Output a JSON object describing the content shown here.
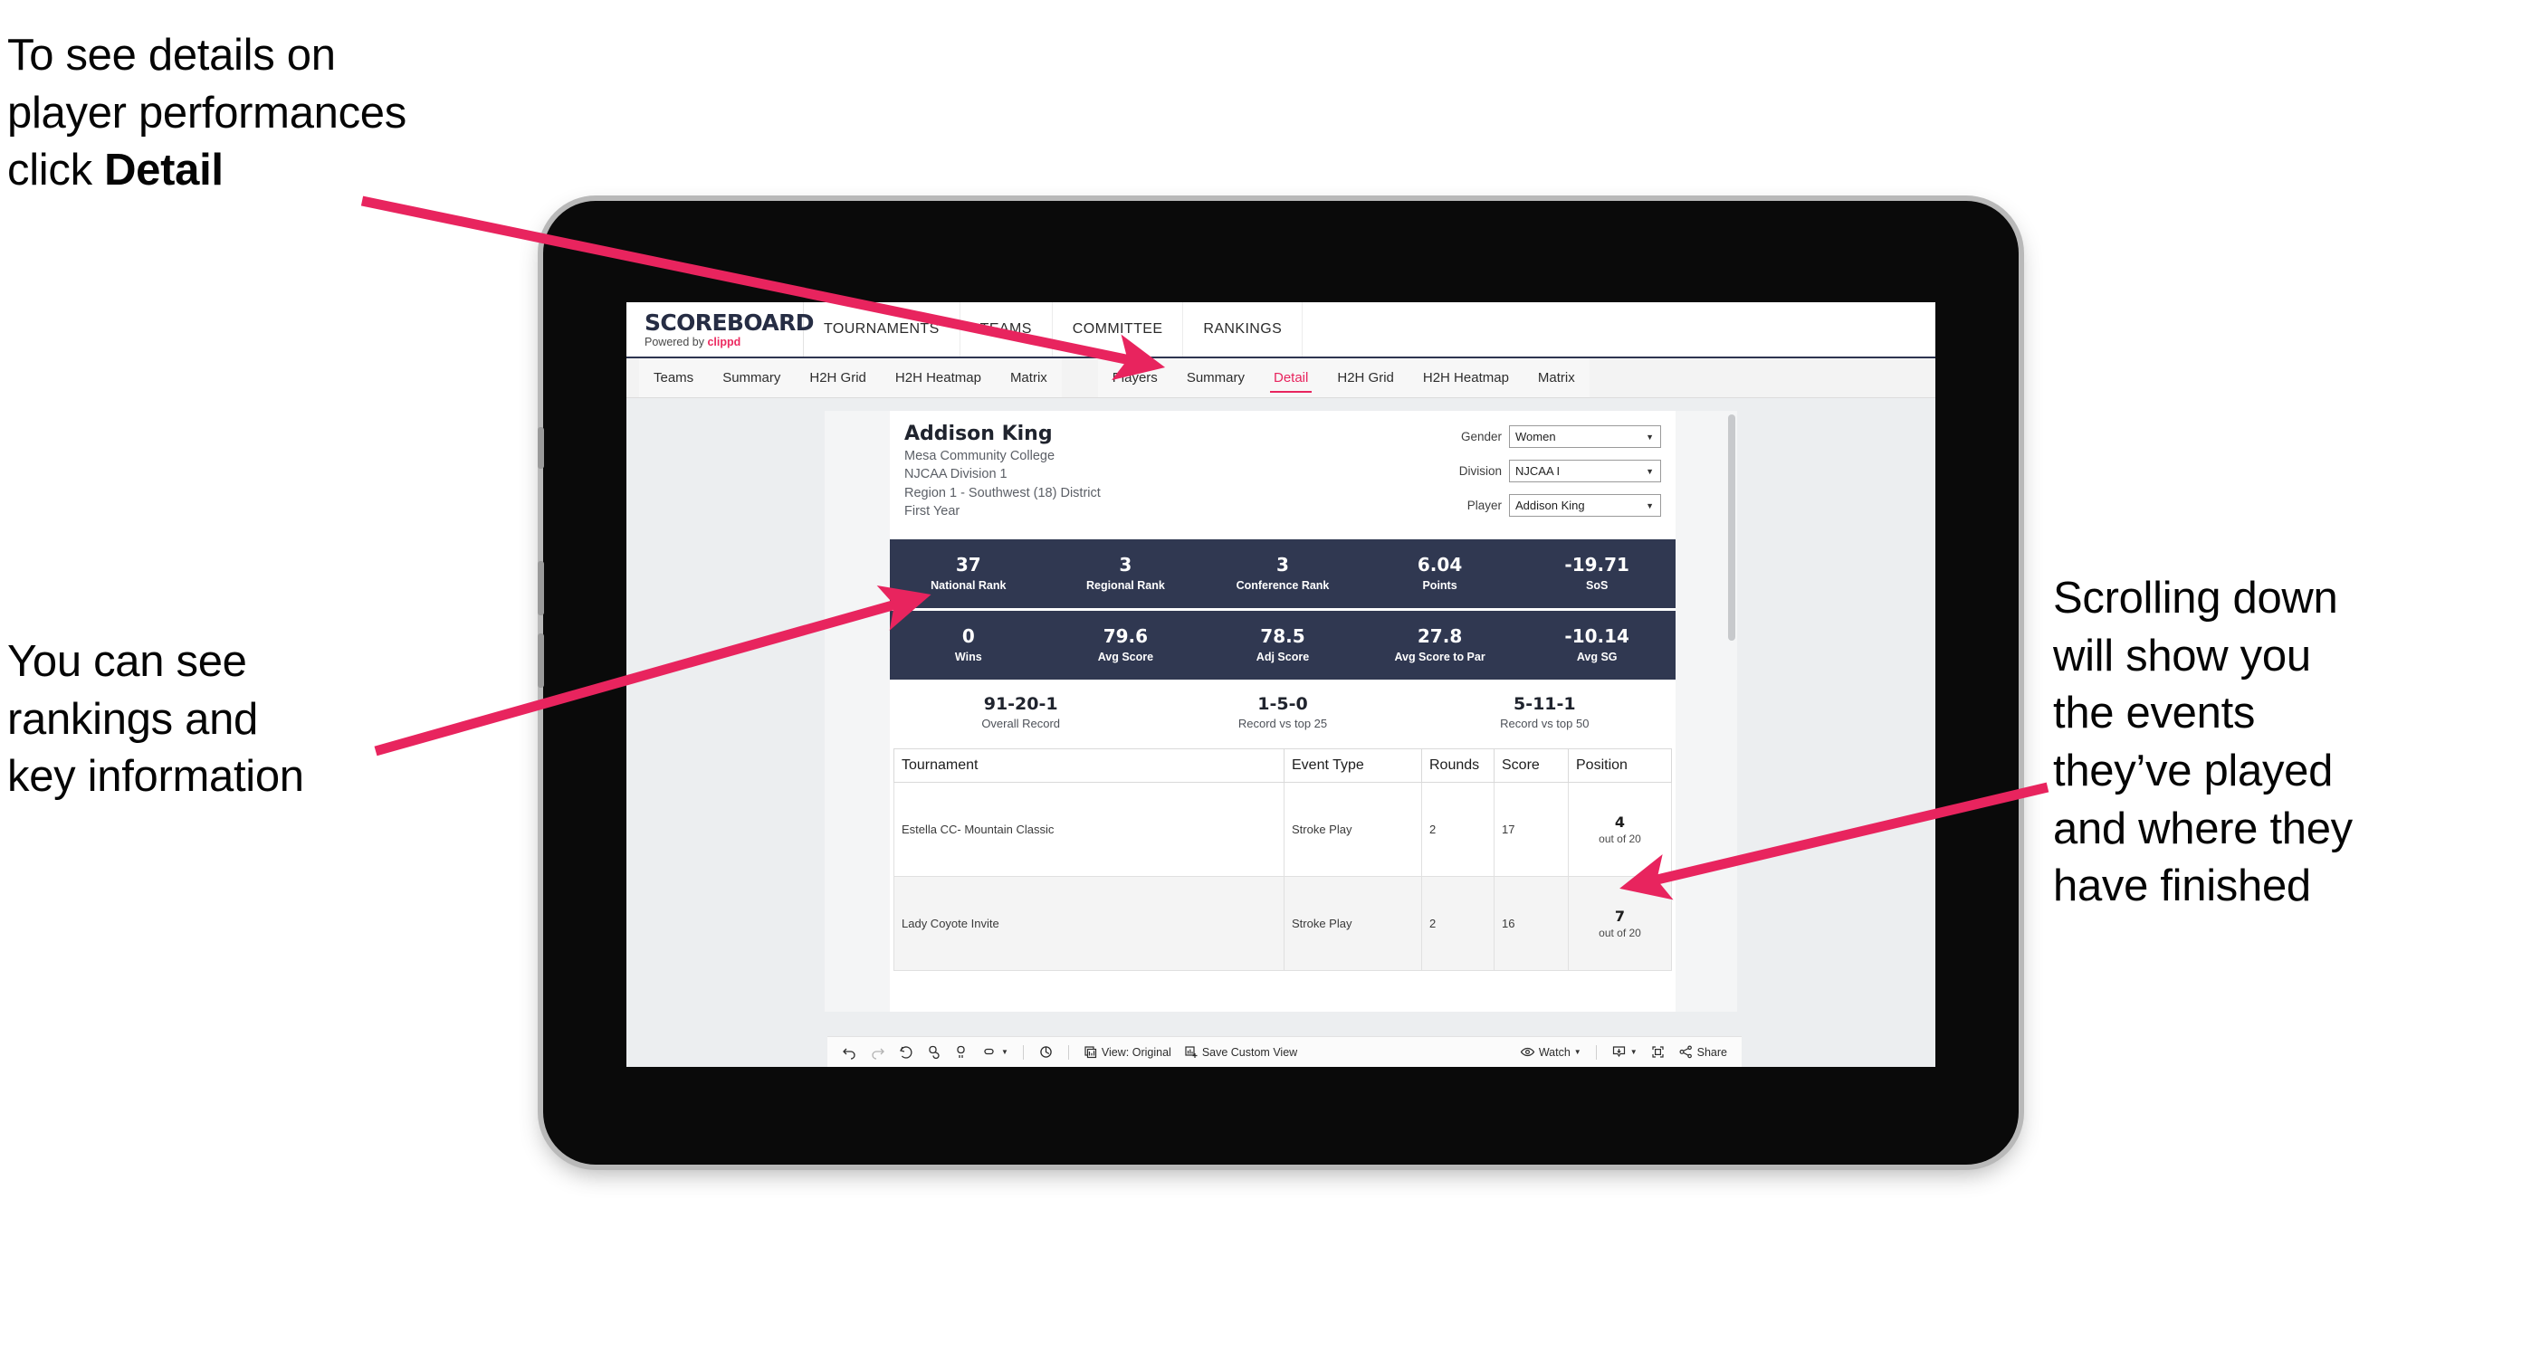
{
  "annotations": {
    "top_left_pre": "To see details on\nplayer performances\nclick ",
    "top_left_bold": "Detail",
    "mid_left": "You can see\nrankings and\nkey information",
    "right": "Scrolling down\nwill show you\nthe events\nthey’ve played\nand where they\nhave finished"
  },
  "colors": {
    "accent_pink": "#e8245e",
    "band_navy": "#303851",
    "brand_navy": "#262d44"
  },
  "app": {
    "brand": {
      "name": "SCOREBOARD",
      "powered_prefix": "Powered by ",
      "powered_brand": "clippd"
    },
    "top_nav": [
      {
        "label": "TOURNAMENTS"
      },
      {
        "label": "TEAMS"
      },
      {
        "label": "COMMITTEE"
      },
      {
        "label": "RANKINGS"
      }
    ],
    "tabs_left": [
      {
        "label": "Teams",
        "active": false
      },
      {
        "label": "Summary",
        "active": false
      },
      {
        "label": "H2H Grid",
        "active": false
      },
      {
        "label": "H2H Heatmap",
        "active": false
      },
      {
        "label": "Matrix",
        "active": false
      }
    ],
    "tabs_right": [
      {
        "label": "Players",
        "active": false
      },
      {
        "label": "Summary",
        "active": false
      },
      {
        "label": "Detail",
        "active": true
      },
      {
        "label": "H2H Grid",
        "active": false
      },
      {
        "label": "H2H Heatmap",
        "active": false
      },
      {
        "label": "Matrix",
        "active": false
      }
    ],
    "player": {
      "name": "Addison King",
      "school": "Mesa Community College",
      "division": "NJCAA Division 1",
      "region": "Region 1 - Southwest (18) District",
      "class_year": "First Year"
    },
    "filters": [
      {
        "label": "Gender",
        "value": "Women"
      },
      {
        "label": "Division",
        "value": "NJCAA I"
      },
      {
        "label": "Player",
        "value": "Addison King"
      }
    ],
    "stat_bands": [
      [
        {
          "value": "37",
          "label": "National Rank"
        },
        {
          "value": "3",
          "label": "Regional Rank"
        },
        {
          "value": "3",
          "label": "Conference Rank"
        },
        {
          "value": "6.04",
          "label": "Points"
        },
        {
          "value": "-19.71",
          "label": "SoS"
        }
      ],
      [
        {
          "value": "0",
          "label": "Wins"
        },
        {
          "value": "79.6",
          "label": "Avg Score"
        },
        {
          "value": "78.5",
          "label": "Adj Score"
        },
        {
          "value": "27.8",
          "label": "Avg Score to Par"
        },
        {
          "value": "-10.14",
          "label": "Avg SG"
        }
      ]
    ],
    "records": [
      {
        "value": "91-20-1",
        "label": "Overall Record"
      },
      {
        "value": "1-5-0",
        "label": "Record vs top 25"
      },
      {
        "value": "5-11-1",
        "label": "Record vs top 50"
      }
    ],
    "events_table": {
      "columns": [
        "Tournament",
        "Event Type",
        "Rounds",
        "Score",
        "Position"
      ],
      "rows": [
        {
          "tournament": "Estella CC- Mountain Classic",
          "event_type": "Stroke Play",
          "rounds": "2",
          "score": "17",
          "position_value": "4",
          "position_out_of": "out of 20"
        },
        {
          "tournament": "Lady Coyote Invite",
          "event_type": "Stroke Play",
          "rounds": "2",
          "score": "16",
          "position_value": "7",
          "position_out_of": "out of 20"
        }
      ]
    },
    "toolbar": {
      "view_label": "View: Original",
      "save_label": "Save Custom View",
      "watch_label": "Watch",
      "share_label": "Share"
    }
  }
}
